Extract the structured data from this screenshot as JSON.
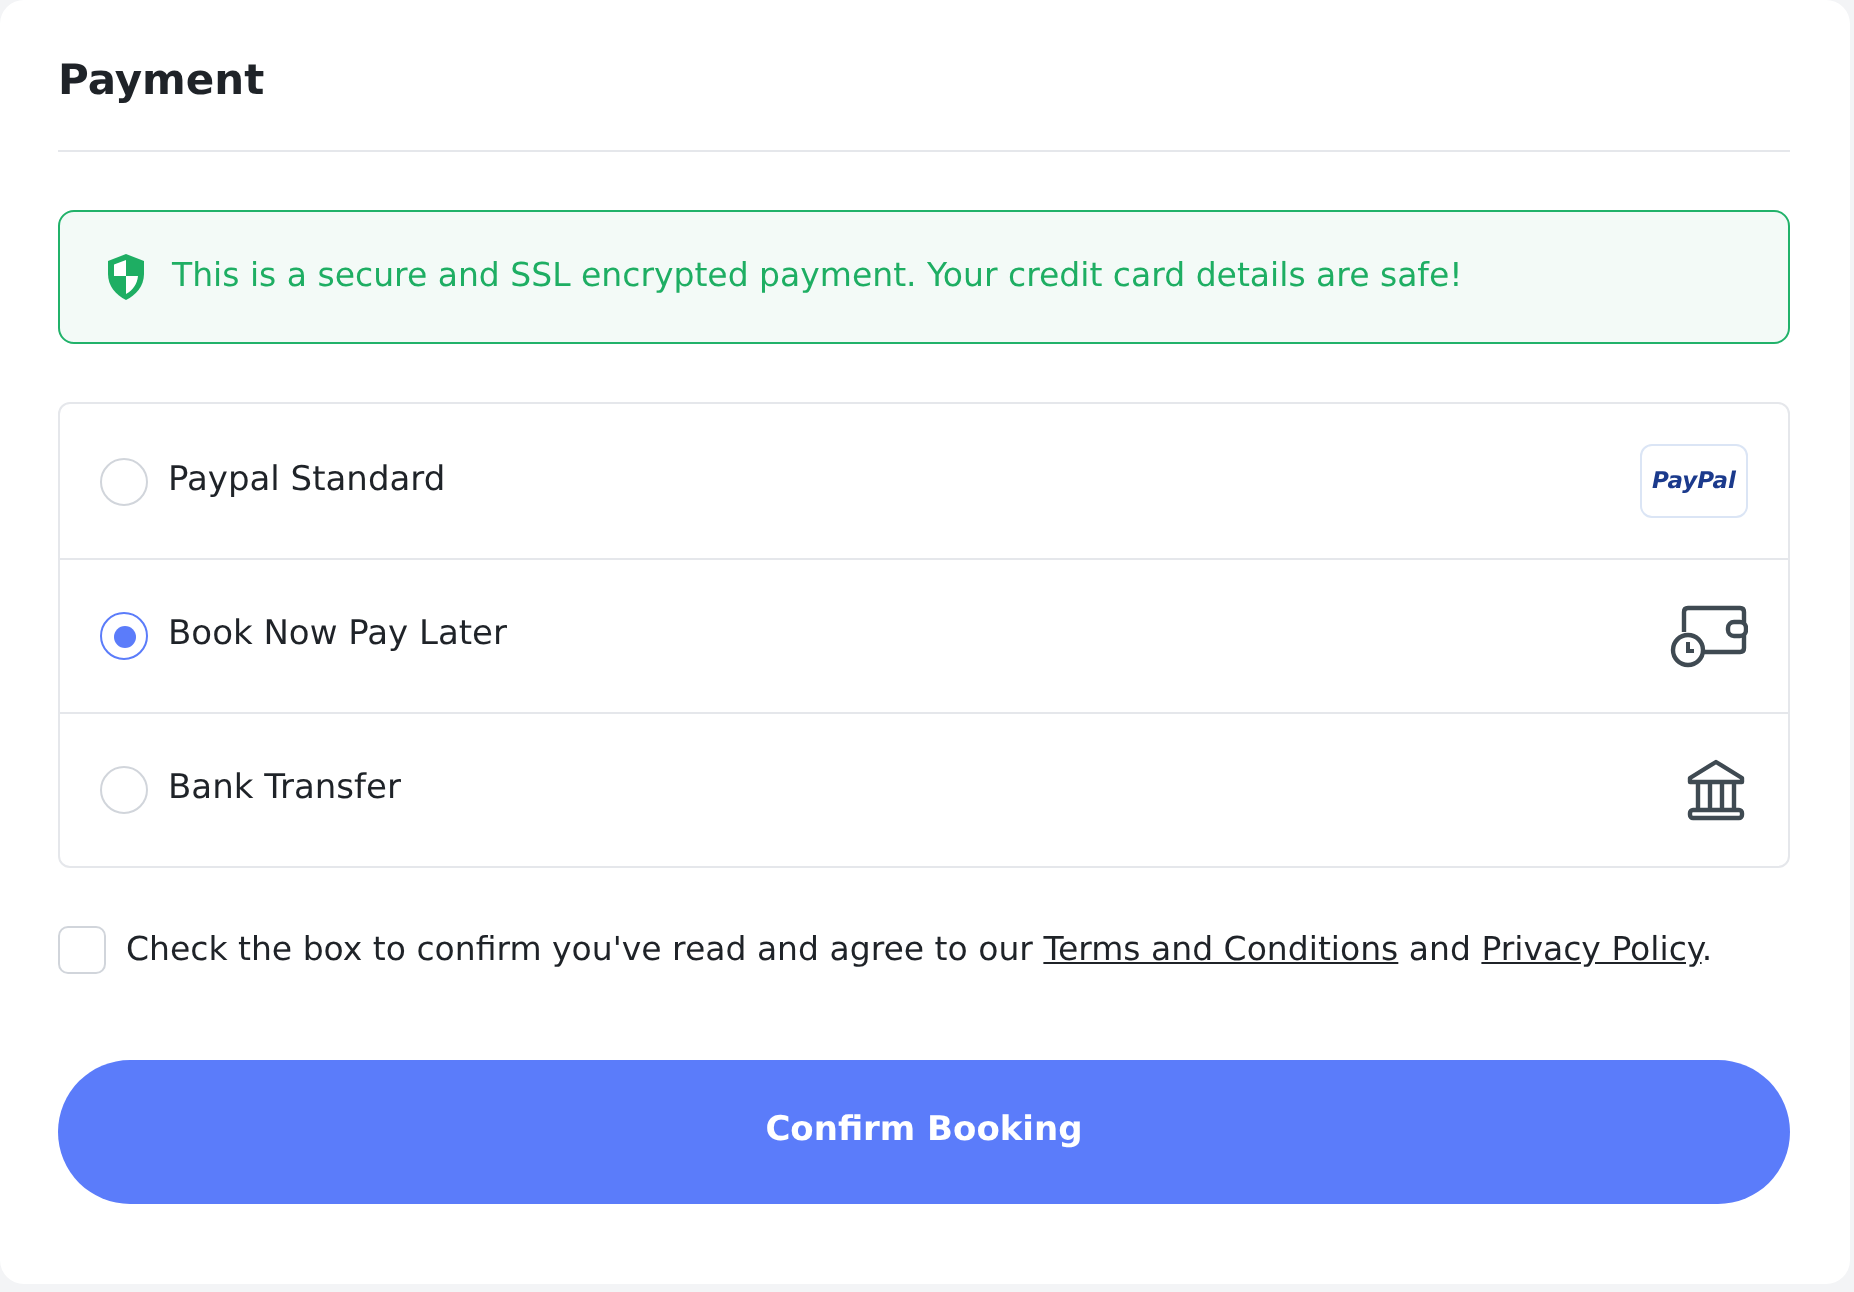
{
  "title": "Payment",
  "alert": {
    "text": "This is a secure and SSL encrypted payment. Your credit card details are safe!"
  },
  "methods": [
    {
      "label": "Paypal Standard",
      "selected": false,
      "kind": "paypal",
      "logo_text": "PayPal"
    },
    {
      "label": "Book Now Pay Later",
      "selected": true,
      "kind": "wallet"
    },
    {
      "label": "Bank Transfer",
      "selected": false,
      "kind": "bank"
    }
  ],
  "agreement": {
    "checked": false,
    "parts": [
      {
        "kind": "text",
        "text": "Check the box to confirm you've read and agree to our "
      },
      {
        "kind": "link",
        "text": "Terms and Conditions"
      },
      {
        "kind": "text",
        "text": " and "
      },
      {
        "kind": "link",
        "text": "Privacy Policy"
      },
      {
        "kind": "text",
        "text": "."
      }
    ]
  },
  "button": {
    "label": "Confirm Booking"
  }
}
